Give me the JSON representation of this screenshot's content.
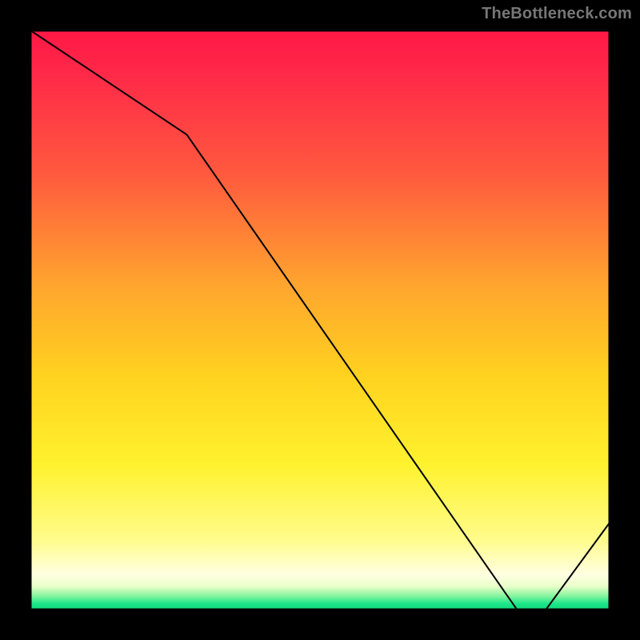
{
  "watermark": "TheBottleneck.com",
  "chart_data": {
    "type": "line",
    "title": "",
    "xlabel": "",
    "ylabel": "",
    "xlim": [
      0,
      100
    ],
    "ylim": [
      0,
      100
    ],
    "x": [
      0,
      27,
      84,
      89,
      100
    ],
    "values": [
      100,
      82,
      0,
      0,
      15
    ],
    "band_label": "",
    "colors": {
      "top": "#ff1846",
      "mid_upper": "#ffa52e",
      "mid": "#fff22e",
      "pale": "#ffffe2",
      "green": "#12d879",
      "line": "#000000"
    }
  }
}
